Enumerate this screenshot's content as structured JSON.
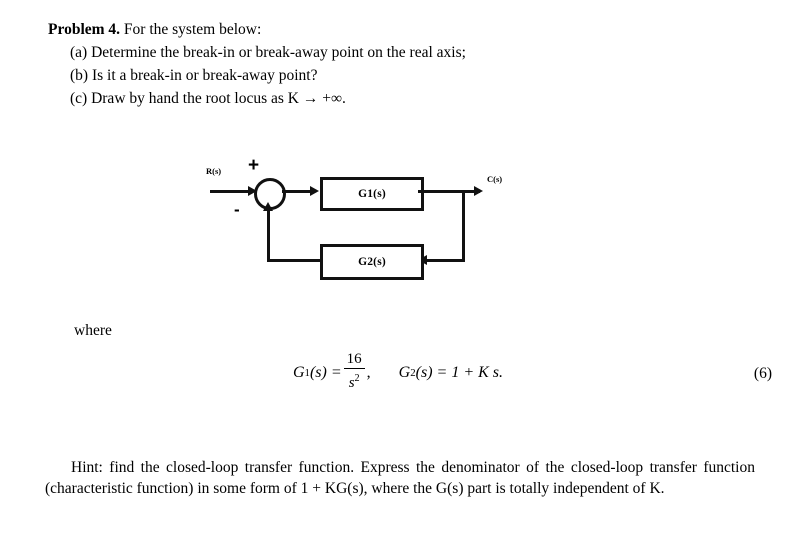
{
  "problem": {
    "label": "Problem 4.",
    "intro": "For the system below:",
    "items": [
      "(a) Determine the break-in or break-away point on the real axis;",
      "(b) Is it a break-in or break-away point?",
      "(c) Draw by hand the root locus as K → +∞."
    ]
  },
  "diagram": {
    "input_label": "R(s)",
    "output_label": "C(s)",
    "plus_sign": "+",
    "minus_sign": "-",
    "forward_block": "G1(s)",
    "feedback_block": "G2(s)"
  },
  "where_label": "where",
  "equation": {
    "g1_name": "G",
    "g1_sub": "1",
    "g1_arg": "(s) =",
    "g1_numerator": "16",
    "g1_denominator": "s",
    "g1_den_exp": "2",
    "g1_comma": ",",
    "g2_name": "G",
    "g2_sub": "2",
    "g2_expr": "(s) = 1 + K s.",
    "number": "(6)"
  },
  "hint": {
    "text": "Hint: find the closed-loop transfer function. Express the denominator of the closed-loop transfer function (characteristic function) in some form of 1 + KG(s), where the G(s) part is totally independent of K."
  },
  "colors": {
    "ink": "#000000",
    "diagram_stroke": "#111111",
    "background": "#ffffff"
  }
}
